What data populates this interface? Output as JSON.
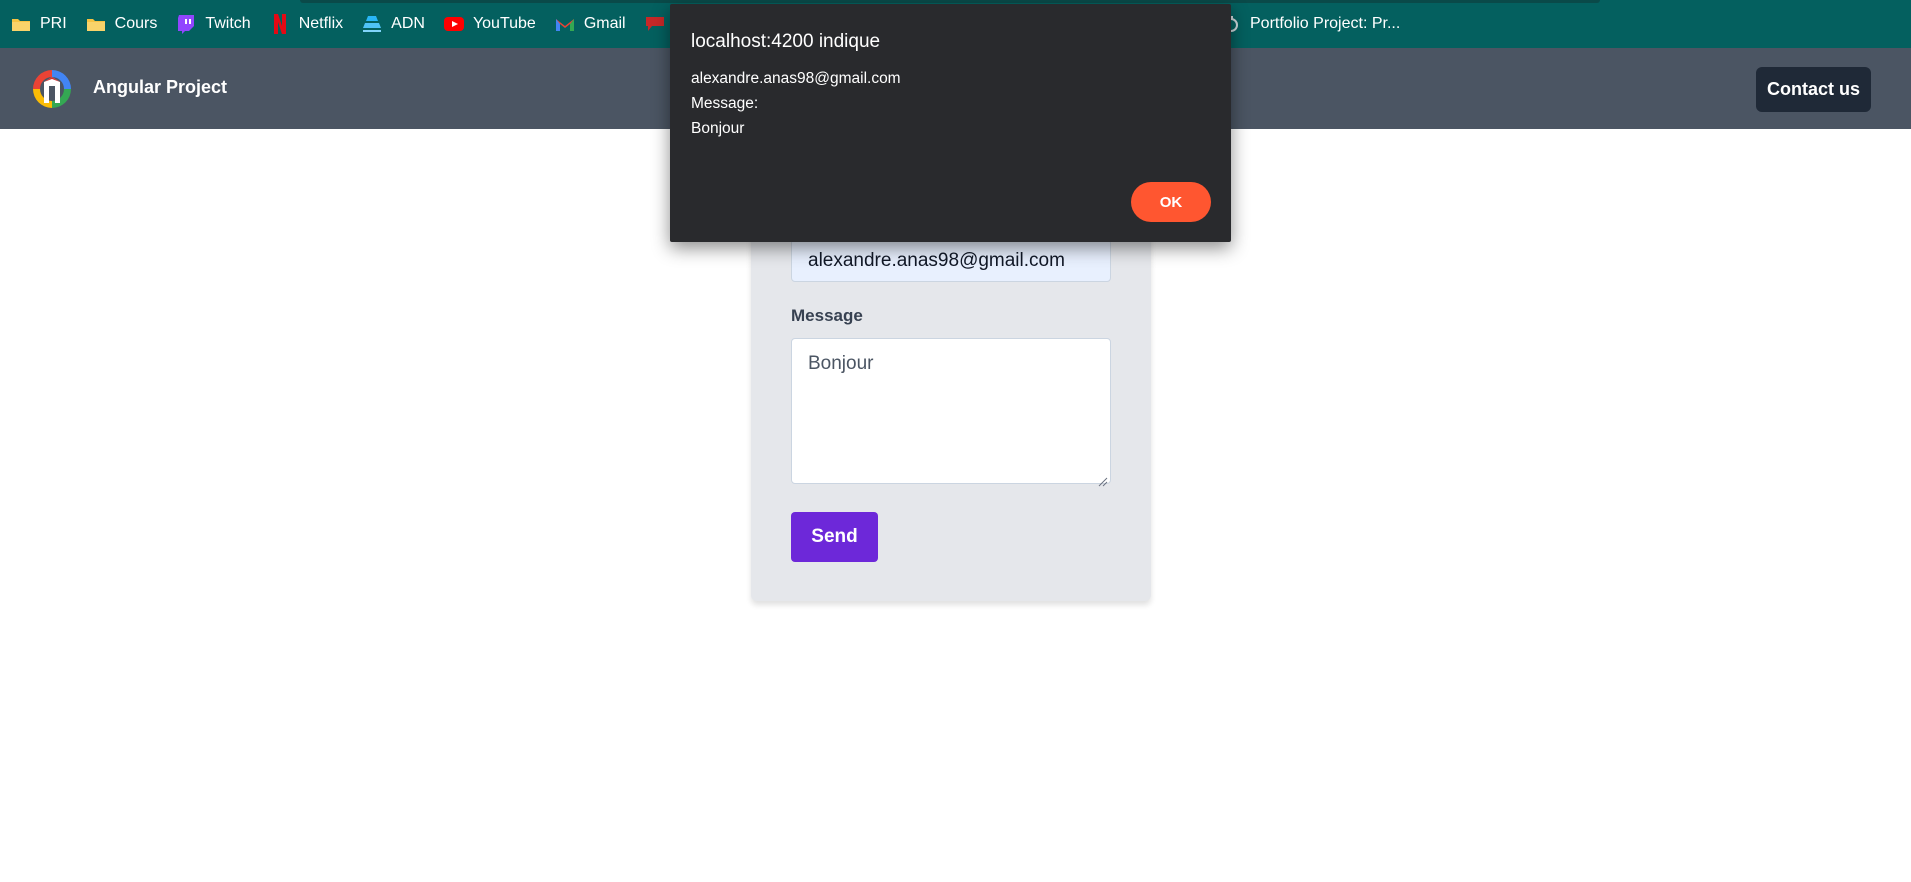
{
  "bookmarks": [
    {
      "label": "PRI",
      "icon": "folder-icon"
    },
    {
      "label": "Cours",
      "icon": "folder-icon"
    },
    {
      "label": "Twitch",
      "icon": "twitch-icon"
    },
    {
      "label": "Netflix",
      "icon": "netflix-icon"
    },
    {
      "label": "ADN",
      "icon": "adn-icon"
    },
    {
      "label": "YouTube",
      "icon": "youtube-icon"
    },
    {
      "label": "Gmail",
      "icon": "gmail-icon"
    },
    {
      "label": "Portfolio Project: Pr...",
      "icon": "portfolio-icon"
    }
  ],
  "header": {
    "title": "Angular Project",
    "contact_label": "Contact us"
  },
  "form": {
    "email_value": "alexandre.anas98@gmail.com",
    "message_label": "Message",
    "message_value": "Bonjour",
    "send_label": "Send"
  },
  "dialog": {
    "title": "localhost:4200 indique",
    "line1": "alexandre.anas98@gmail.com",
    "line2": "Message:",
    "line3": "Bonjour",
    "ok_label": "OK"
  },
  "colors": {
    "bookmarks_bg": "#04605f",
    "header_bg": "#4b5563",
    "contact_bg": "#1f2937",
    "card_bg": "#e5e7eb",
    "send_bg": "#6d28d9",
    "dialog_bg": "#292a2d",
    "ok_bg": "#ff5630"
  }
}
